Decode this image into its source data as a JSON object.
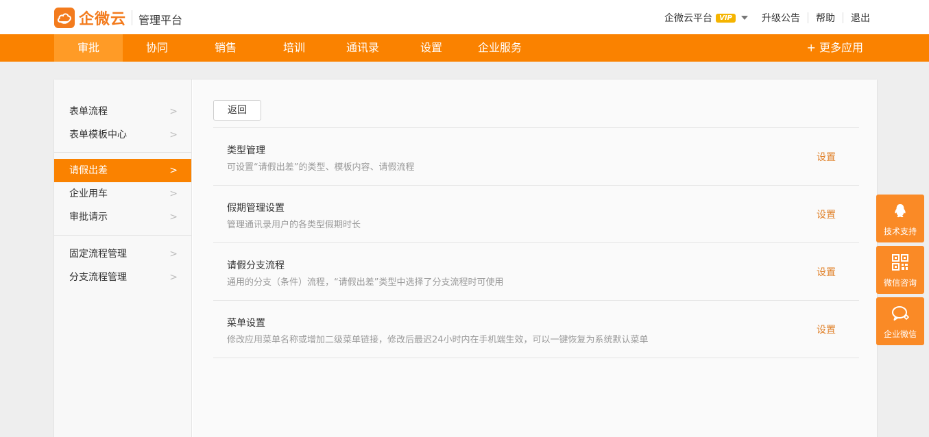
{
  "header": {
    "logo_text": "企微云",
    "logo_sub": "管理平台",
    "platform_label": "企微云平台",
    "vip_badge": "VIP",
    "links": {
      "upgrade": "升级公告",
      "help": "帮助",
      "logout": "退出"
    }
  },
  "nav": {
    "items": [
      "审批",
      "协同",
      "销售",
      "培训",
      "通讯录",
      "设置",
      "企业服务"
    ],
    "active": "审批",
    "more": "+ 更多应用"
  },
  "sidebar": {
    "group1": [
      "表单流程",
      "表单模板中心"
    ],
    "group2": [
      "请假出差",
      "企业用车",
      "审批请示"
    ],
    "group3": [
      "固定流程管理",
      "分支流程管理"
    ],
    "active": "请假出差",
    "arrow": ">"
  },
  "content": {
    "back_label": "返回",
    "rows": [
      {
        "title": "类型管理",
        "desc": "可设置“请假出差”的类型、模板内容、请假流程",
        "action": "设置"
      },
      {
        "title": "假期管理设置",
        "desc": "管理通讯录用户的各类型假期时长",
        "action": "设置"
      },
      {
        "title": "请假分支流程",
        "desc": "通用的分支（条件）流程，“请假出差”类型中选择了分支流程时可使用",
        "action": "设置"
      },
      {
        "title": "菜单设置",
        "desc": "修改应用菜单名称或增加二级菜单链接，修改后最迟24小时内在手机端生效，可以一键恢复为系统默认菜单",
        "action": "设置"
      }
    ]
  },
  "float_buttons": {
    "tech_support": "技术支持",
    "wechat_consult": "微信咨询",
    "enterprise_wechat": "企业微信"
  },
  "colors": {
    "brand": "#fa8200",
    "nav_active": "#ff9b26",
    "action_link": "#e0812a"
  }
}
